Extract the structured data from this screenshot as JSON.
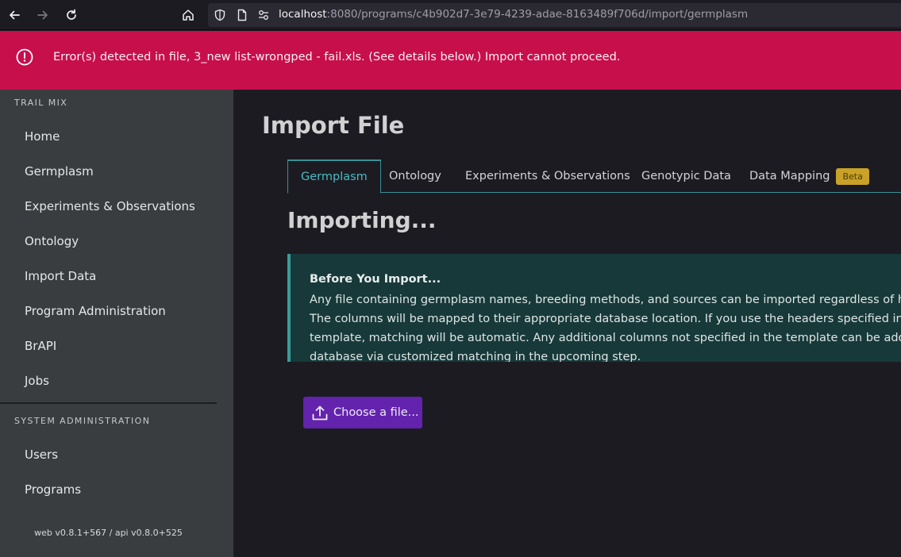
{
  "browser": {
    "url_host": "localhost",
    "url_rest": ":8080/programs/c4b902d7-3e79-4239-adae-8163489f706d/import/germplasm"
  },
  "error_banner": {
    "message": "Error(s) detected in file, 3_new list-wrongped - fail.xls. (See details below.) Import cannot proceed.",
    "color": "#c70f4c"
  },
  "sidebar": {
    "program_label": "TRAIL MIX",
    "items": [
      {
        "label": "Home"
      },
      {
        "label": "Germplasm"
      },
      {
        "label": "Experiments & Observations"
      },
      {
        "label": "Ontology"
      },
      {
        "label": "Import Data"
      },
      {
        "label": "Program Administration"
      },
      {
        "label": "BrAPI"
      },
      {
        "label": "Jobs"
      }
    ],
    "admin_label": "SYSTEM ADMINISTRATION",
    "admin_items": [
      {
        "label": "Users"
      },
      {
        "label": "Programs"
      }
    ],
    "version": "web v0.8.1+567 / api v0.8.0+525"
  },
  "main": {
    "title": "Import File",
    "tabs": [
      {
        "label": "Germplasm",
        "active": true
      },
      {
        "label": "Ontology"
      },
      {
        "label": "Experiments & Observations"
      },
      {
        "label": "Genotypic Data"
      },
      {
        "label": "Data Mapping",
        "badge": "Beta"
      }
    ],
    "status_heading": "Importing...",
    "notice": {
      "title": "Before You Import...",
      "body": "Any file containing germplasm names, breeding methods, and sources can be imported regardless of header format. The columns will be mapped to their appropriate database location. If you use the headers specified in the import template, matching will be automatic. Any additional columns not specified in the template can be added to the database via customized matching in the upcoming step."
    },
    "choose_button": "Choose a file..."
  },
  "colors": {
    "accent_teal": "#48bcc3",
    "button_purple": "#6323ad",
    "beta_badge": "#c9a227",
    "sidebar_bg": "#3a3d3f",
    "notice_bg": "#17393a"
  }
}
